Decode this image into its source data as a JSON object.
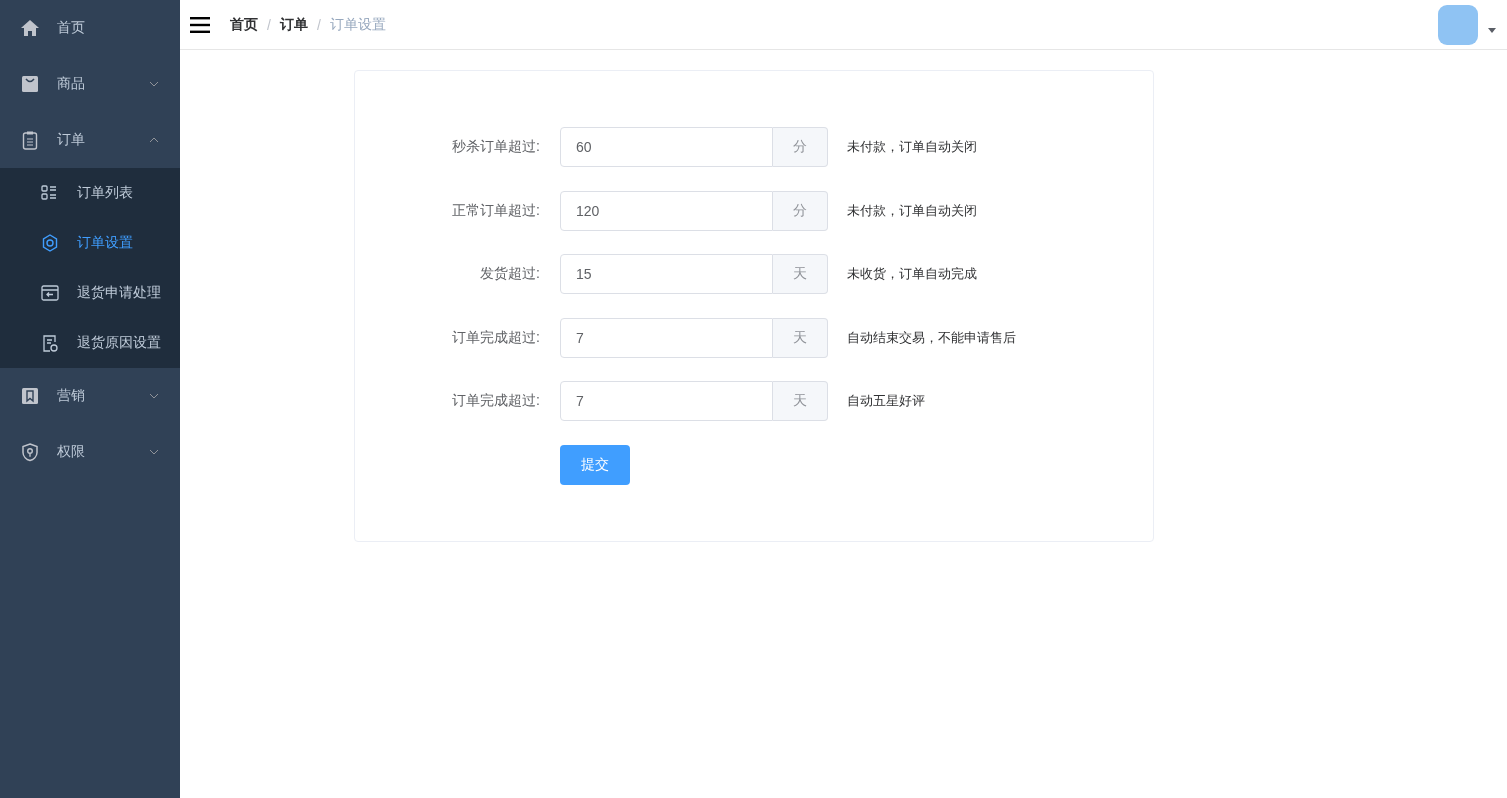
{
  "sidebar": {
    "items": [
      {
        "label": "首页"
      },
      {
        "label": "商品",
        "expanded": false
      },
      {
        "label": "订单",
        "expanded": true,
        "children": [
          {
            "label": "订单列表",
            "selected": false
          },
          {
            "label": "订单设置",
            "selected": true
          },
          {
            "label": "退货申请处理",
            "selected": false
          },
          {
            "label": "退货原因设置",
            "selected": false
          }
        ]
      },
      {
        "label": "营销",
        "expanded": false
      },
      {
        "label": "权限",
        "expanded": false
      }
    ]
  },
  "breadcrumb": {
    "separator": "/",
    "items": [
      {
        "label": "首页",
        "current": false
      },
      {
        "label": "订单",
        "current": false
      },
      {
        "label": "订单设置",
        "current": true
      }
    ]
  },
  "form": {
    "fields": [
      {
        "label": "秒杀订单超过:",
        "value": "60",
        "unit": "分",
        "note": "未付款，订单自动关闭"
      },
      {
        "label": "正常订单超过:",
        "value": "120",
        "unit": "分",
        "note": "未付款，订单自动关闭"
      },
      {
        "label": "发货超过:",
        "value": "15",
        "unit": "天",
        "note": "未收货，订单自动完成"
      },
      {
        "label": "订单完成超过:",
        "value": "7",
        "unit": "天",
        "note": "自动结束交易，不能申请售后"
      },
      {
        "label": "订单完成超过:",
        "value": "7",
        "unit": "天",
        "note": "自动五星好评"
      }
    ],
    "submit": "提交"
  }
}
